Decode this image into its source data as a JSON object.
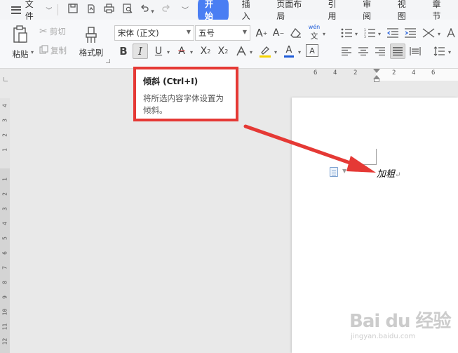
{
  "menu": {
    "file_label": "文件",
    "tabs": [
      {
        "label": "开始",
        "active": true
      },
      {
        "label": "插入",
        "active": false
      },
      {
        "label": "页面布局",
        "active": false
      },
      {
        "label": "引用",
        "active": false
      },
      {
        "label": "审阅",
        "active": false
      },
      {
        "label": "视图",
        "active": false
      },
      {
        "label": "章节",
        "active": false
      }
    ]
  },
  "toolbar": {
    "paste_label": "粘贴",
    "cut_label": "剪切",
    "copy_label": "复制",
    "format_painter_label": "格式刷",
    "font_name": "宋体 (正文)",
    "font_size": "五号",
    "phonetic_glyph": "wén"
  },
  "ruler": {
    "horizontal_numbers": [
      "6",
      "4",
      "2",
      "2",
      "4",
      "6"
    ],
    "vertical_numbers": [
      "4",
      "3",
      "2",
      "1",
      "1",
      "2",
      "3",
      "4",
      "5",
      "6",
      "7",
      "8",
      "9",
      "10",
      "11",
      "12"
    ]
  },
  "tooltip": {
    "title": "倾斜 (Ctrl+I)",
    "body": "将所选内容字体设置为倾斜。"
  },
  "document": {
    "text": "加粗",
    "paragraph_mark": "↵"
  },
  "watermark": {
    "logo": "Bai du 经验",
    "url": "jingyan.baidu.com"
  },
  "colors": {
    "active_tab": "#4a7ef3",
    "tooltip_border": "#e53935",
    "arrow": "#e53935",
    "font_color_underline": "#1e5bd8",
    "highlight_underline": "#f5d300"
  }
}
